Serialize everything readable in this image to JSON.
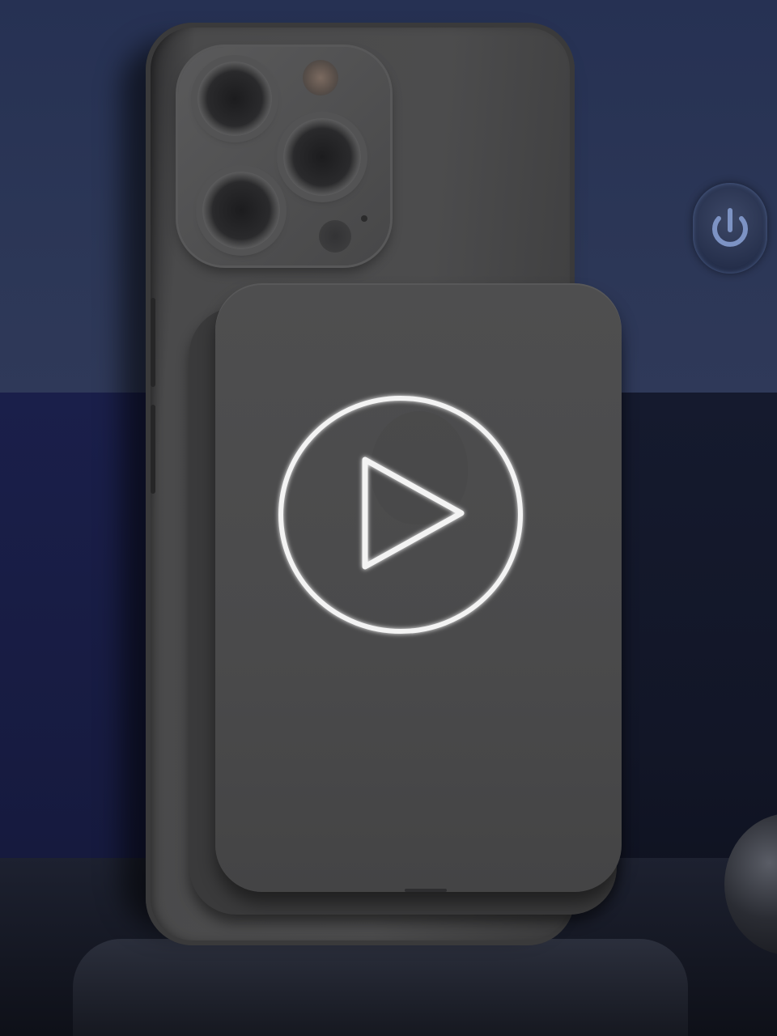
{
  "scene": {
    "subject": "phone-with-magnetic-battery-pack",
    "icons": [
      "power-icon",
      "play-icon"
    ]
  },
  "video": {
    "play_control": "play-button"
  },
  "colors": {
    "wall": "#2b3656",
    "phone": "#4a4a4b",
    "play_icon": "#ffffff"
  }
}
